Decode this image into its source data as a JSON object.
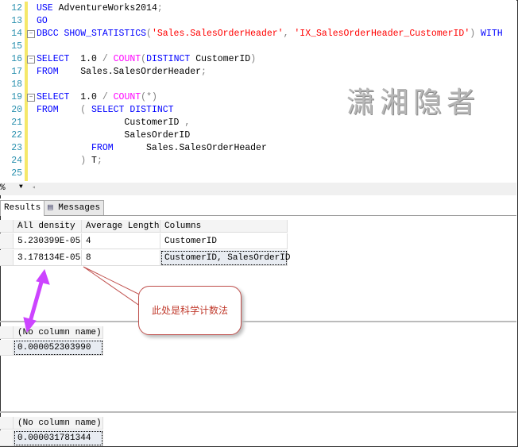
{
  "editor": {
    "line_numbers": [
      "12",
      "13",
      "14",
      "15",
      "16",
      "17",
      "18",
      "19",
      "20",
      "21",
      "22",
      "23",
      "24",
      "25"
    ],
    "lines": [
      [
        [
          "kw",
          "USE"
        ],
        [
          "pl",
          " AdventureWorks2014"
        ],
        [
          "op",
          ";"
        ]
      ],
      [
        [
          "kw",
          "GO"
        ]
      ],
      [
        [
          "kw",
          "DBCC SHOW_STATISTICS"
        ],
        [
          "op",
          "("
        ],
        [
          "str",
          "'Sales.SalesOrderHeader'"
        ],
        [
          "op",
          ", "
        ],
        [
          "str",
          "'IX_SalesOrderHeader_CustomerID'"
        ],
        [
          "op",
          ")"
        ],
        [
          "kw",
          " WITH"
        ]
      ],
      [],
      [
        [
          "kw",
          "SELECT"
        ],
        [
          "pl",
          "  1.0 "
        ],
        [
          "op",
          "/"
        ],
        [
          "pl",
          " "
        ],
        [
          "fn",
          "COUNT"
        ],
        [
          "op",
          "("
        ],
        [
          "kw",
          "DISTINCT"
        ],
        [
          "pl",
          " CustomerID"
        ],
        [
          "op",
          ")"
        ]
      ],
      [
        [
          "kw",
          "FROM"
        ],
        [
          "pl",
          "    Sales.SalesOrderHeader"
        ],
        [
          "op",
          ";"
        ]
      ],
      [],
      [
        [
          "kw",
          "SELECT"
        ],
        [
          "pl",
          "  1.0 "
        ],
        [
          "op",
          "/"
        ],
        [
          "pl",
          " "
        ],
        [
          "fn",
          "COUNT"
        ],
        [
          "op",
          "(*)"
        ]
      ],
      [
        [
          "kw",
          "FROM"
        ],
        [
          "pl",
          "    "
        ],
        [
          "op",
          "("
        ],
        [
          "pl",
          " "
        ],
        [
          "kw",
          "SELECT DISTINCT"
        ]
      ],
      [
        [
          "pl",
          "                CustomerID "
        ],
        [
          "op",
          ","
        ]
      ],
      [
        [
          "pl",
          "                SalesOrderID"
        ]
      ],
      [
        [
          "pl",
          "          "
        ],
        [
          "kw",
          "FROM"
        ],
        [
          "pl",
          "      Sales.SalesOrderHeader"
        ]
      ],
      [
        [
          "pl",
          "        "
        ],
        [
          "op",
          ")"
        ],
        [
          "pl",
          " T"
        ],
        [
          "op",
          ";"
        ]
      ],
      []
    ],
    "watermark": "潇湘隐者"
  },
  "status": {
    "zoom": "%"
  },
  "tabs": [
    {
      "label": "Results"
    },
    {
      "label": "Messages"
    }
  ],
  "grid1": {
    "columns": [
      "All density",
      "Average Length",
      "Columns"
    ],
    "rows": [
      [
        "5.230399E-05",
        "4",
        "CustomerID"
      ],
      [
        "3.178134E-05",
        "8",
        "CustomerID, SalesOrderID"
      ]
    ]
  },
  "grid2": {
    "column": "(No column name)",
    "value": "0.000052303990"
  },
  "grid3": {
    "column": "(No column name)",
    "value": "0.000031781344"
  },
  "annotation": {
    "text": "此处是科学计数法",
    "arrow_color": "#cc44ff",
    "border_color": "#c0504d"
  }
}
